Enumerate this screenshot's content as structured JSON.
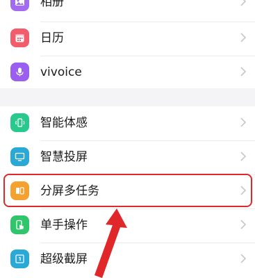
{
  "settings": {
    "items": [
      {
        "label": "相册",
        "icon": "album-icon",
        "color": "#a36cf0"
      },
      {
        "label": "日历",
        "icon": "calendar-icon",
        "color": "#f25c6b"
      },
      {
        "label": "vivoice",
        "icon": "microphone-icon",
        "color": "#9b5ff0"
      },
      {
        "label": "智能体感",
        "icon": "smart-motion-icon",
        "color": "#29c98d"
      },
      {
        "label": "智慧投屏",
        "icon": "screen-cast-icon",
        "color": "#2aa9d6"
      },
      {
        "label": "分屏多任务",
        "icon": "split-screen-icon",
        "color": "#f4a12f"
      },
      {
        "label": "单手操作",
        "icon": "one-hand-icon",
        "color": "#2fc56a"
      },
      {
        "label": "超级截屏",
        "icon": "super-screenshot-icon",
        "color": "#2aa9d6"
      }
    ]
  },
  "annotation": {
    "highlight_color": "#e0282a",
    "highlighted_item": "分屏多任务"
  }
}
